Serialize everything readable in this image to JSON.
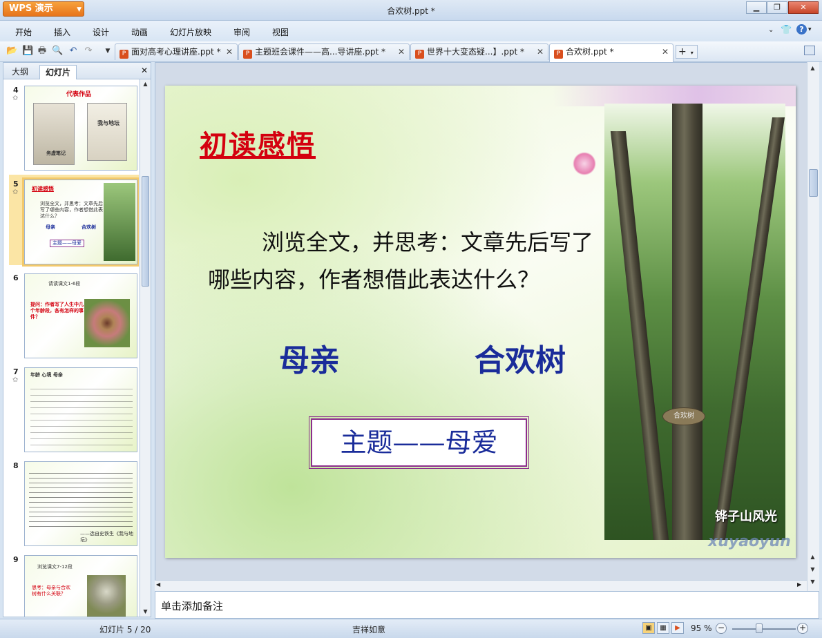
{
  "app": {
    "button_label": "WPS 演示",
    "doc_title": "合欢树.ppt *"
  },
  "menu": [
    "开始",
    "插入",
    "设计",
    "动画",
    "幻灯片放映",
    "审阅",
    "视图"
  ],
  "tabs": [
    {
      "label": "面对高考心理讲座.ppt *"
    },
    {
      "label": "主题班会课件——高...导讲座.ppt *"
    },
    {
      "label": "世界十大变态疑...】.ppt *"
    },
    {
      "label": "合欢树.ppt *"
    }
  ],
  "panel": {
    "tab_outline": "大纲",
    "tab_slides": "幻灯片"
  },
  "thumbnails": [
    {
      "num": "4",
      "title": "代表作品",
      "book": "我与地坛",
      "book2": "务虚笔记"
    },
    {
      "num": "5",
      "title": "初读感悟",
      "line": "浏览全文，并思考：文章先后写了哪些内容，作者想借此表达什么？",
      "kw1": "母亲",
      "kw2": "合欢树",
      "theme": "主题——母爱"
    },
    {
      "num": "6",
      "title": "请读课文1-6段",
      "q": "提问：作者写了人生中几个年龄段，各有怎样的事件？"
    },
    {
      "num": "7",
      "title": "年龄  心境  母亲"
    },
    {
      "num": "8",
      "title": "——选自史铁生《我与地坛》"
    },
    {
      "num": "9",
      "title": "浏览课文7-12段",
      "q": "思考：母亲与合欢树有什么关联？"
    }
  ],
  "slide": {
    "title": "初读感悟",
    "body": "浏览全文，并思考：文章先后写了哪些内容，作者想借此表达什么？",
    "keyword1": "母亲",
    "keyword2": "合欢树",
    "theme": "主题——母爱",
    "photo_caption": "铧子山风光",
    "watermark": "xuyaoyun",
    "sign": "合欢树"
  },
  "notes_placeholder": "单击添加备注",
  "status": {
    "slide_counter": "幻灯片 5 / 20",
    "theme_name": "吉祥如意",
    "zoom": "95 %"
  },
  "colors": {
    "title_red": "#d4000f",
    "keyword_blue": "#1a2c9a",
    "theme_border": "#8c2e8c",
    "app_orange": "#e7741b"
  }
}
